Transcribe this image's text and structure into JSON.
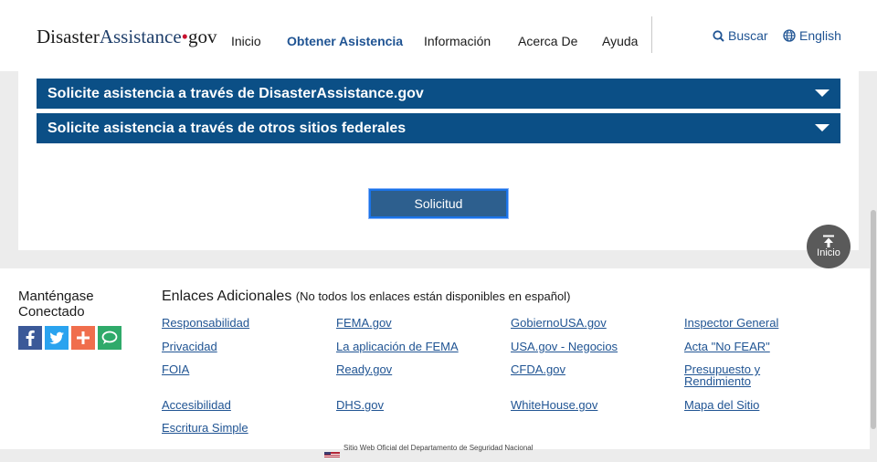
{
  "header": {
    "logo": {
      "part1": "Disaster",
      "part2": "Assistance",
      "dot": "•",
      "part3": "gov"
    },
    "nav": [
      {
        "label": "Inicio",
        "active": false
      },
      {
        "label": "Obtener Asistencia",
        "active": true
      },
      {
        "label": "Información",
        "active": false
      },
      {
        "label": "Acerca De",
        "active": false
      },
      {
        "label": "Ayuda",
        "active": false
      }
    ],
    "search_label": "Buscar",
    "language_label": "English"
  },
  "main": {
    "accordions": [
      {
        "label": "Solicite asistencia a través de DisasterAssistance.gov"
      },
      {
        "label": "Solicite asistencia a través de otros sitios federales"
      }
    ],
    "apply_button": "Solicitud"
  },
  "back_to_top": {
    "label": "Inicio"
  },
  "footer": {
    "connect_title": "Manténgase Conectado",
    "social_icons": [
      "facebook-icon",
      "twitter-icon",
      "share-plus-icon",
      "chat-icon"
    ],
    "links_title": "Enlaces Adicionales",
    "links_note": "(No todos los enlaces están disponibles en español)",
    "links": [
      [
        "Responsabilidad",
        "FEMA.gov",
        "GobiernoUSA.gov",
        "Inspector General"
      ],
      [
        "Privacidad",
        "La aplicación de FEMA",
        "USA.gov - Negocios",
        "Acta \"No FEAR\""
      ],
      [
        "FOIA",
        "Ready.gov",
        "CFDA.gov",
        "Presupuesto y Rendimiento"
      ],
      [
        "Accesibilidad",
        "DHS.gov",
        "WhiteHouse.gov",
        "Mapa del Sitio"
      ],
      [
        "Escritura Simple"
      ]
    ],
    "gov_banner": "Sitio Web Oficial del Departamento de Seguridad Nacional"
  },
  "colors": {
    "brand_blue": "#0b4f86",
    "link_blue": "#205493",
    "logo_red": "#c8102e",
    "page_bg": "#ececec"
  }
}
